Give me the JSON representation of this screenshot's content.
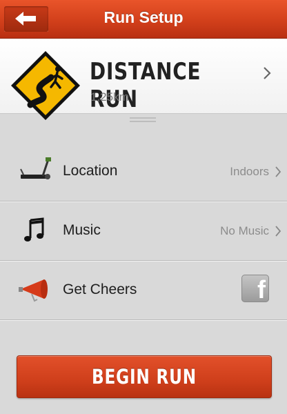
{
  "header": {
    "title": "Run Setup",
    "back_icon": "arrow-left-icon",
    "color": "#d2401b"
  },
  "run": {
    "title": "DISTANCE RUN",
    "distance": "1,25km",
    "sign_icon": "winding-road-runner-sign-icon"
  },
  "settings": [
    {
      "label": "Location",
      "value": "Indoors",
      "icon": "treadmill-icon"
    },
    {
      "label": "Music",
      "value": "No Music",
      "icon": "music-note-icon"
    },
    {
      "label": "Get Cheers",
      "value": "",
      "icon": "megaphone-icon",
      "action_icon": "facebook-icon"
    }
  ],
  "begin_button": {
    "label": "BEGIN RUN",
    "color": "#cf3f1b"
  }
}
